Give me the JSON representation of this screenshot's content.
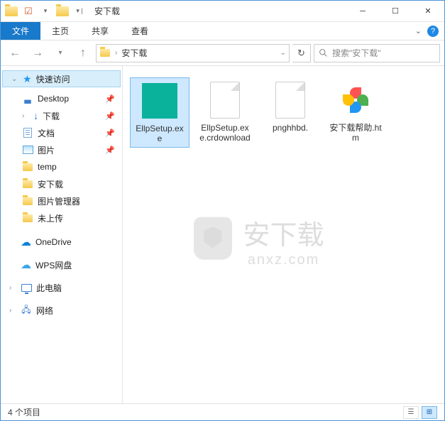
{
  "title": "安下载",
  "ribbon": {
    "file": "文件",
    "home": "主页",
    "share": "共享",
    "view": "查看"
  },
  "address": {
    "segment": "安下载"
  },
  "search": {
    "placeholder": "搜索\"安下载\""
  },
  "sidebar": {
    "quick_access": "快速访问",
    "items": [
      {
        "label": "Desktop",
        "icon": "desktop"
      },
      {
        "label": "下载",
        "icon": "download"
      },
      {
        "label": "文档",
        "icon": "doc"
      },
      {
        "label": "图片",
        "icon": "pic"
      },
      {
        "label": "temp",
        "icon": "folder"
      },
      {
        "label": "安下载",
        "icon": "folder"
      },
      {
        "label": "图片管理器",
        "icon": "folder"
      },
      {
        "label": "未上传",
        "icon": "folder"
      }
    ],
    "onedrive": "OneDrive",
    "wps": "WPS网盘",
    "thispc": "此电脑",
    "network": "网络"
  },
  "files": [
    {
      "name": "EllpSetup.exe",
      "thumb": "exe",
      "selected": true
    },
    {
      "name": "EllpSetup.exe.crdownload",
      "thumb": "blank",
      "selected": false
    },
    {
      "name": "pnghhbd.",
      "thumb": "blank",
      "selected": false
    },
    {
      "name": "安下载帮助.htm",
      "thumb": "pinwheel",
      "selected": false
    }
  ],
  "watermark": {
    "main": "安下载",
    "sub": "anxz.com"
  },
  "status": {
    "count": "4 个项目"
  }
}
